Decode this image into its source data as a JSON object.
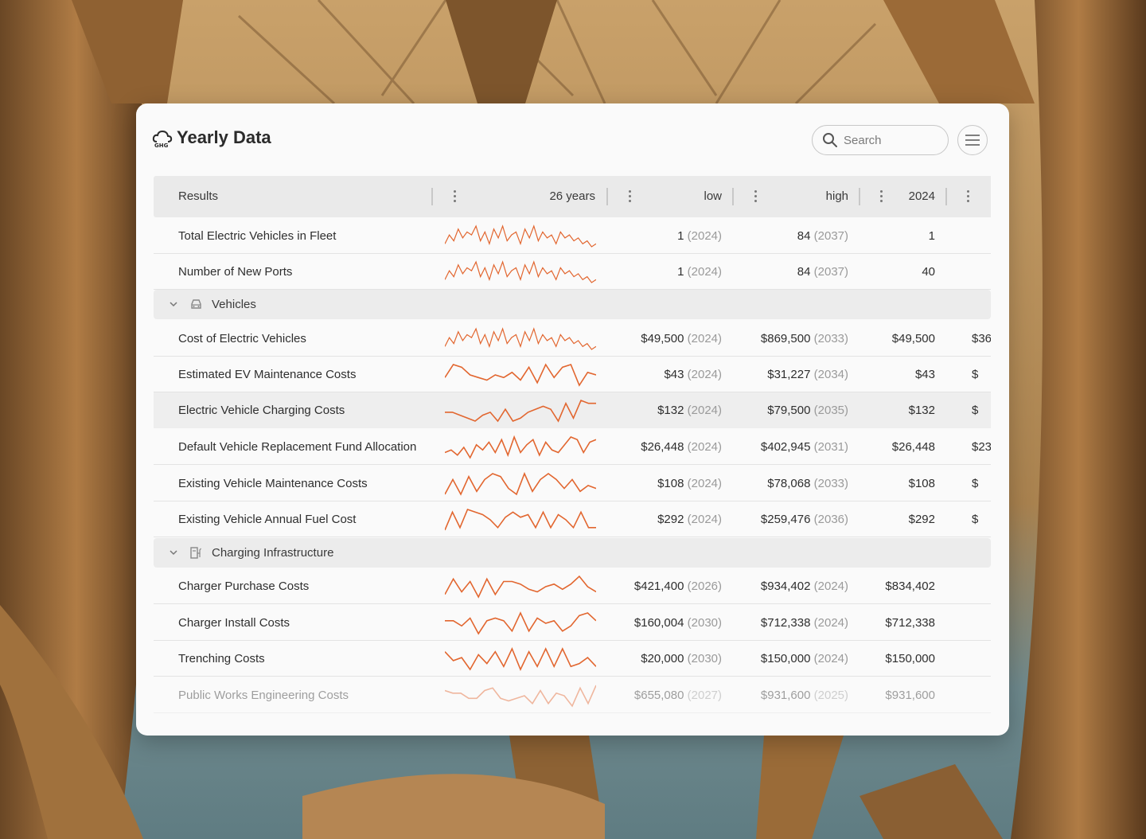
{
  "header": {
    "logo_text": "GHG",
    "title": "Yearly Data",
    "search_placeholder": "Search"
  },
  "columns": {
    "results": "Results",
    "trend": "26 years",
    "low": "low",
    "high": "high",
    "year": "2024"
  },
  "colors": {
    "spark": "#e2662f",
    "card": "#fafafa",
    "header_row": "#eaeaea"
  },
  "rows": [
    {
      "name": "Total Electric Vehicles in Fleet",
      "low": "1",
      "low_year": "(2024)",
      "high": "84",
      "high_year": "(2037)",
      "y2024": "1",
      "next": "",
      "spark": [
        3,
        6,
        4,
        8,
        5,
        7,
        6,
        9,
        4,
        7,
        3,
        8,
        5,
        9,
        4,
        6,
        7,
        3,
        8,
        5,
        9,
        4,
        7,
        5,
        6,
        3,
        7,
        5,
        6,
        4,
        5,
        3,
        4,
        2,
        3
      ]
    },
    {
      "name": "Number of New Ports",
      "low": "1",
      "low_year": "(2024)",
      "high": "84",
      "high_year": "(2037)",
      "y2024": "40",
      "next": "",
      "spark": [
        3,
        6,
        4,
        8,
        5,
        7,
        6,
        9,
        4,
        7,
        3,
        8,
        5,
        9,
        4,
        6,
        7,
        3,
        8,
        5,
        9,
        4,
        7,
        5,
        6,
        3,
        7,
        5,
        6,
        4,
        5,
        3,
        4,
        2,
        3
      ]
    },
    {
      "group": "Vehicles",
      "icon": "car-icon"
    },
    {
      "name": "Cost of Electric Vehicles",
      "low": "$49,500",
      "low_year": "(2024)",
      "high": "$869,500",
      "high_year": "(2033)",
      "y2024": "$49,500",
      "next": "$36",
      "spark": [
        3,
        6,
        4,
        8,
        5,
        7,
        6,
        9,
        4,
        7,
        3,
        8,
        5,
        9,
        4,
        6,
        7,
        3,
        8,
        5,
        9,
        4,
        7,
        5,
        6,
        3,
        7,
        5,
        6,
        4,
        5,
        3,
        4,
        2,
        3
      ]
    },
    {
      "name": "Estimated EV Maintenance Costs",
      "low": "$43",
      "low_year": "(2024)",
      "high": "$31,227",
      "high_year": "(2034)",
      "y2024": "$43",
      "next": "$",
      "spark": [
        4,
        9,
        8,
        5,
        4,
        3,
        5,
        4,
        6,
        3,
        8,
        2,
        9,
        4,
        8,
        9,
        1,
        6,
        5
      ]
    },
    {
      "name": "Electric Vehicle Charging Costs",
      "low": "$132",
      "low_year": "(2024)",
      "high": "$79,500",
      "high_year": "(2035)",
      "y2024": "$132",
      "next": "$",
      "spark": [
        5,
        5,
        4,
        3,
        2,
        4,
        5,
        2,
        6,
        2,
        3,
        5,
        6,
        7,
        6,
        2,
        8,
        3,
        9,
        8,
        8
      ]
    },
    {
      "name": "Default Vehicle Replacement Fund Allocation",
      "low": "$26,448",
      "low_year": "(2024)",
      "high": "$402,945",
      "high_year": "(2031)",
      "y2024": "$26,448",
      "next": "$23",
      "spark": [
        3,
        4,
        2,
        5,
        1,
        6,
        4,
        7,
        3,
        8,
        2,
        9,
        3,
        6,
        8,
        2,
        7,
        4,
        3,
        6,
        9,
        8,
        3,
        7,
        8
      ]
    },
    {
      "name": "Existing Vehicle Maintenance Costs",
      "low": "$108",
      "low_year": "(2024)",
      "high": "$78,068",
      "high_year": "(2033)",
      "y2024": "$108",
      "next": "$",
      "spark": [
        2,
        7,
        2,
        8,
        3,
        7,
        9,
        8,
        4,
        2,
        9,
        3,
        7,
        9,
        7,
        4,
        7,
        3,
        5,
        4
      ]
    },
    {
      "name": "Existing Vehicle Annual Fuel Cost",
      "low": "$292",
      "low_year": "(2024)",
      "high": "$259,476",
      "high_year": "(2036)",
      "y2024": "$292",
      "next": "$",
      "spark": [
        1,
        8,
        2,
        9,
        8,
        7,
        5,
        2,
        6,
        8,
        6,
        7,
        2,
        8,
        2,
        7,
        5,
        2,
        8,
        2,
        2
      ]
    },
    {
      "group": "Charging Infrastructure",
      "icon": "charging-station-icon"
    },
    {
      "name": "Charger Purchase Costs",
      "low": "$421,400",
      "low_year": "(2026)",
      "high": "$934,402",
      "high_year": "(2024)",
      "y2024": "$834,402",
      "next": "",
      "spark": [
        2,
        8,
        3,
        7,
        1,
        8,
        2,
        7,
        7,
        6,
        4,
        3,
        5,
        6,
        4,
        6,
        9,
        5,
        3
      ]
    },
    {
      "name": "Charger Install Costs",
      "low": "$160,004",
      "low_year": "(2030)",
      "high": "$712,338",
      "high_year": "(2024)",
      "y2024": "$712,338",
      "next": "",
      "spark": [
        6,
        6,
        4,
        7,
        1,
        6,
        7,
        6,
        2,
        9,
        2,
        7,
        5,
        6,
        2,
        4,
        8,
        9,
        6
      ]
    },
    {
      "name": "Trenching Costs",
      "low": "$20,000",
      "low_year": "(2030)",
      "high": "$150,000",
      "high_year": "(2024)",
      "y2024": "$150,000",
      "next": "",
      "spark": [
        7,
        4,
        5,
        1,
        6,
        3,
        7,
        2,
        8,
        1,
        7,
        2,
        8,
        2,
        8,
        2,
        3,
        5,
        2
      ]
    },
    {
      "name": "Public Works Engineering Costs",
      "low": "$655,080",
      "low_year": "(2027)",
      "high": "$931,600",
      "high_year": "(2025)",
      "y2024": "$931,600",
      "next": "",
      "spark": [
        7,
        6,
        6,
        4,
        4,
        7,
        8,
        4,
        3,
        4,
        5,
        2,
        7,
        2,
        6,
        5,
        1,
        8,
        2,
        9
      ]
    }
  ]
}
